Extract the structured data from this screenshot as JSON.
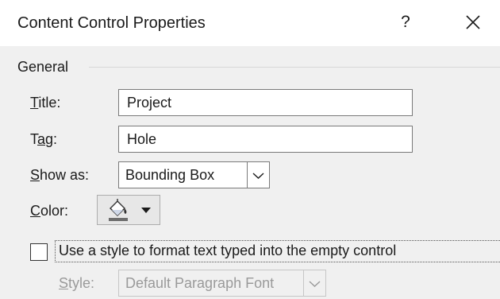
{
  "window": {
    "title": "Content Control Properties",
    "help_label": "?",
    "close_icon": "close-icon"
  },
  "general": {
    "group_label": "General",
    "title_label": {
      "mnemonic": "T",
      "rest": "itle:"
    },
    "title_value": "Project",
    "tag_label": {
      "pre": "T",
      "mnemonic": "a",
      "rest": "g:"
    },
    "tag_value": "Hole",
    "show_as_label": {
      "mnemonic": "S",
      "rest": "how as:"
    },
    "show_as_value": "Bounding Box",
    "color_label": {
      "mnemonic": "C",
      "rest": "olor:"
    },
    "color_icon": "paint-bucket-icon",
    "style_checkbox": {
      "checked": false,
      "label_mnemonic": "U",
      "label_rest": "se a style to format text typed into the empty control"
    },
    "style_label": {
      "mnemonic": "S",
      "rest": "tyle:"
    },
    "style_value": "Default Paragraph Font"
  },
  "colors": {
    "dialog_background": "#f0f0f0",
    "titlebar_background": "#ffffff",
    "border": "#7a7a7a",
    "disabled_text": "#9a9a9a"
  }
}
